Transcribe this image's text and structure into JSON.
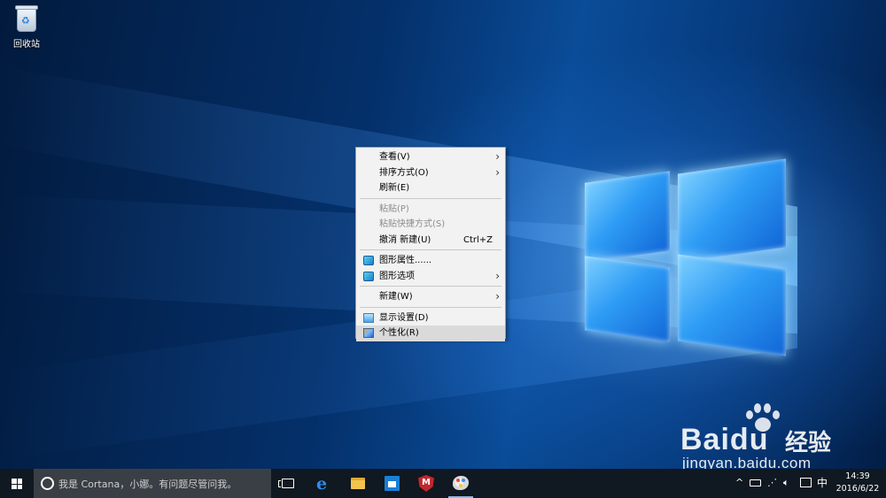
{
  "desktop": {
    "icons": [
      {
        "label": "回收站",
        "icon": "recycle-bin-icon"
      }
    ]
  },
  "context_menu": {
    "items": [
      {
        "label": "查看(V)",
        "submenu": true,
        "enabled": true
      },
      {
        "label": "排序方式(O)",
        "submenu": true,
        "enabled": true
      },
      {
        "label": "刷新(E)",
        "enabled": true
      },
      {
        "label": "粘贴(P)",
        "enabled": false
      },
      {
        "label": "粘贴快捷方式(S)",
        "enabled": false
      },
      {
        "label": "撤消 新建(U)",
        "shortcut": "Ctrl+Z",
        "enabled": true
      },
      {
        "label": "图形属性......",
        "icon": "graphics-icon",
        "enabled": true
      },
      {
        "label": "图形选项",
        "icon": "graphics-icon",
        "submenu": true,
        "enabled": true
      },
      {
        "label": "新建(W)",
        "submenu": true,
        "enabled": true
      },
      {
        "label": "显示设置(D)",
        "icon": "display-icon",
        "enabled": true
      },
      {
        "label": "个性化(R)",
        "icon": "personalize-icon",
        "enabled": true,
        "highlighted": true
      }
    ],
    "chevron": "›"
  },
  "taskbar": {
    "search_placeholder": "我是 Cortana，小娜。有问题尽管问我。",
    "pinned": [
      "task-view-icon",
      "edge-icon",
      "file-explorer-icon",
      "store-icon",
      "mcafee-icon",
      "paint-icon"
    ],
    "tray": {
      "chevron": "^",
      "ime": "中",
      "time": "14:39",
      "date": "2016/6/22"
    }
  },
  "watermark": {
    "brand": "Bai",
    "brand2": "du",
    "product": "经验",
    "url": "jingyan.baidu.com"
  }
}
